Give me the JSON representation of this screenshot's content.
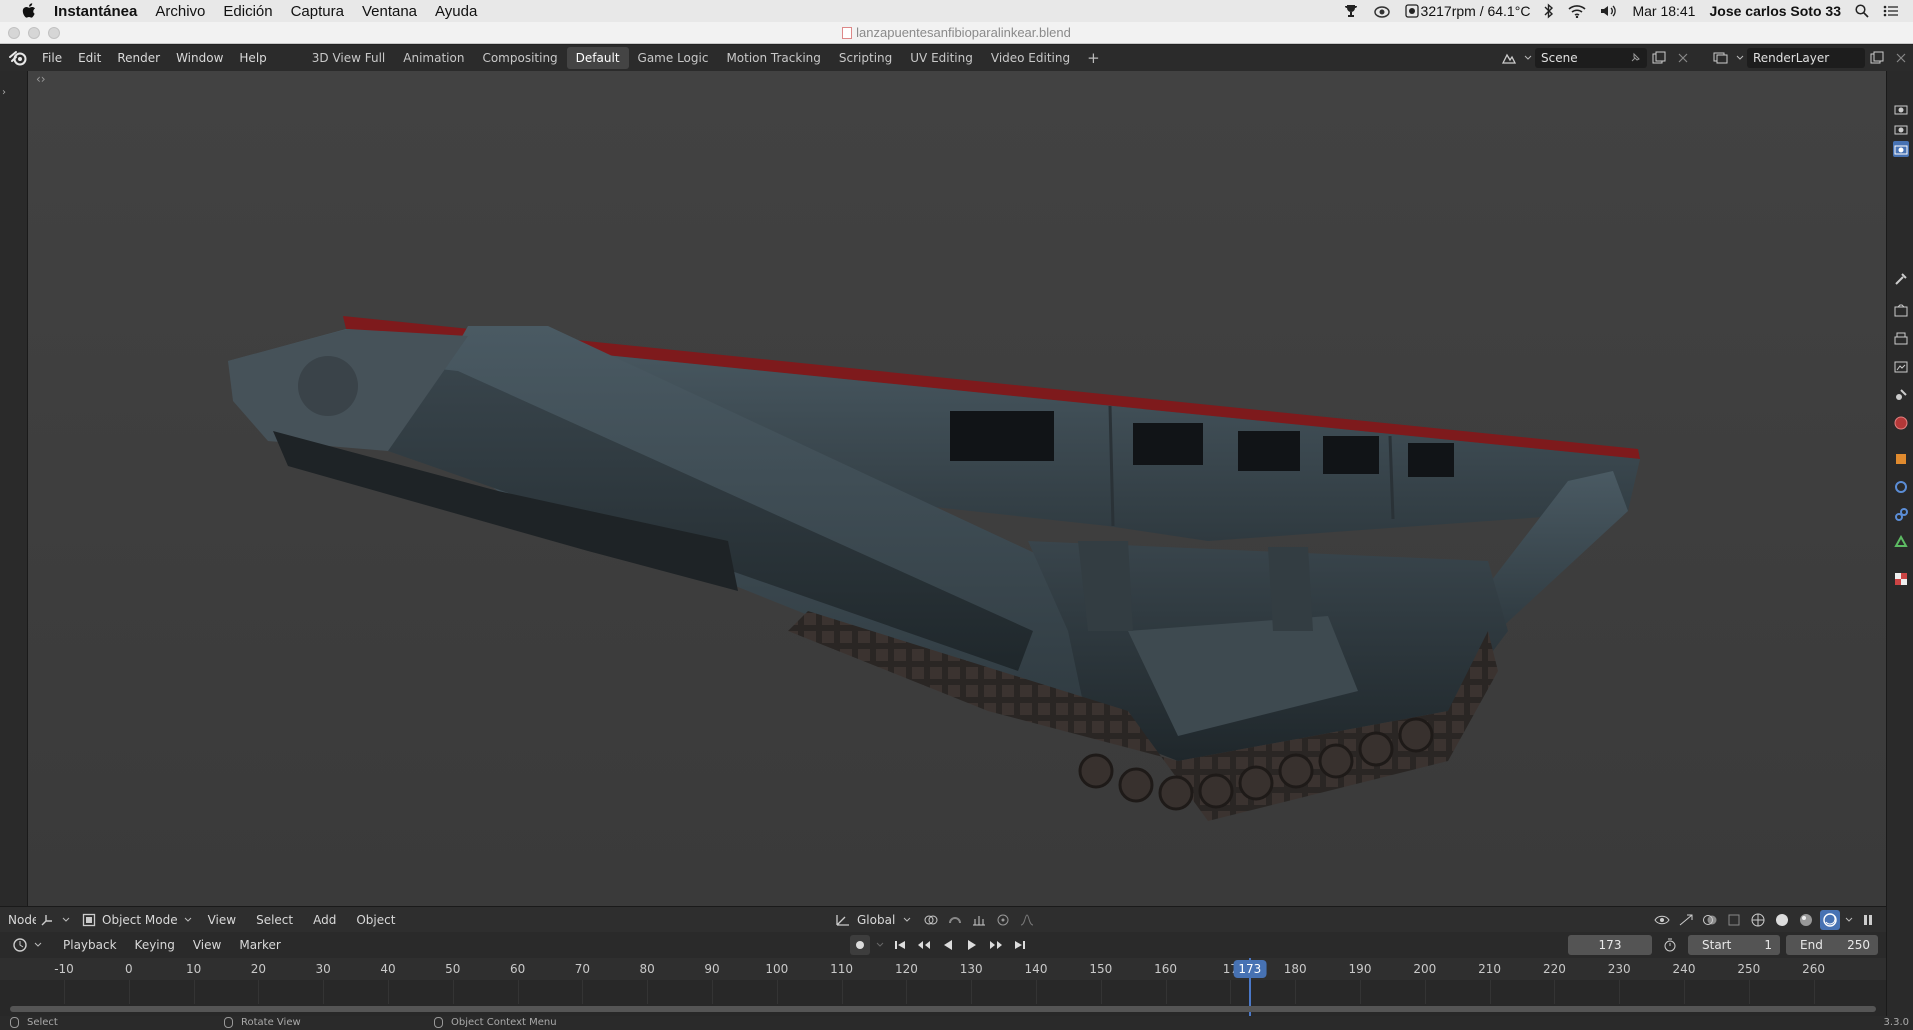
{
  "mac_menu": {
    "app_name": "Instantánea",
    "items": [
      "Archivo",
      "Edición",
      "Captura",
      "Ventana",
      "Ayuda"
    ],
    "fan_status": "3217rpm / 64.1°C",
    "clock": "Mar 18:41",
    "user": "Jose carlos Soto 33"
  },
  "window": {
    "title": "lanzapuentesanfibioparalinkear.blend"
  },
  "topbar": {
    "menus": [
      "File",
      "Edit",
      "Render",
      "Window",
      "Help"
    ],
    "workspaces": [
      "3D View Full",
      "Animation",
      "Compositing",
      "Default",
      "Game Logic",
      "Motion Tracking",
      "Scripting",
      "UV Editing",
      "Video Editing"
    ],
    "active_workspace": "Default",
    "add_label": "+",
    "scene": "Scene",
    "render_layer": "RenderLayer"
  },
  "viewport_header": {
    "editor_label": "Node",
    "mode": "Object Mode",
    "menus": [
      "View",
      "Select",
      "Add",
      "Object"
    ],
    "orientation": "Global"
  },
  "timeline_header": {
    "menus": [
      "Playback",
      "Keying",
      "View",
      "Marker"
    ],
    "current_frame": "173",
    "start_label": "Start",
    "start_value": "1",
    "end_label": "End",
    "end_value": "250"
  },
  "timeline": {
    "ticks": [
      "-10",
      "0",
      "10",
      "20",
      "30",
      "40",
      "50",
      "60",
      "70",
      "80",
      "90",
      "100",
      "110",
      "120",
      "130",
      "140",
      "150",
      "160",
      "17",
      "180",
      "190",
      "200",
      "210",
      "220",
      "230",
      "240",
      "250",
      "260"
    ],
    "cursor_frame": "173"
  },
  "statusbar": {
    "select": "Select",
    "rotate": "Rotate View",
    "context": "Object Context Menu",
    "version": "3.3.0"
  },
  "colors": {
    "viewport_bg": "#3d3d3d",
    "accent_blue": "#4772b3",
    "vehicle_body": "#3f4e56",
    "bridge_red": "#8a1a1c"
  }
}
